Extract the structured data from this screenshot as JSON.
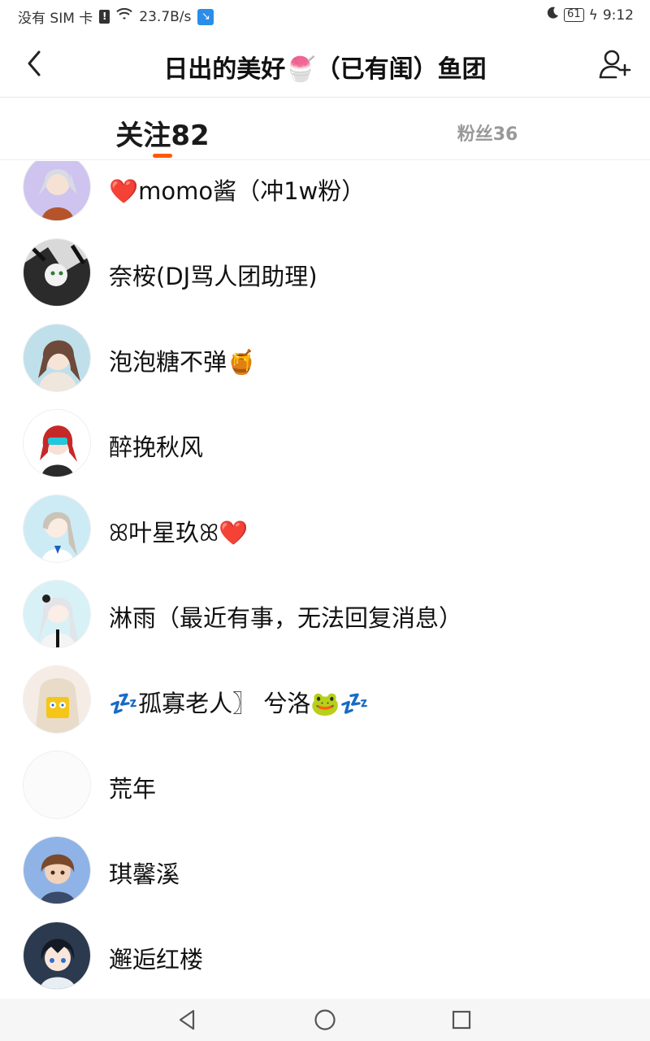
{
  "status_bar": {
    "carrier": "没有 SIM 卡",
    "sim_alert": "!",
    "net_speed": "23.7B/s",
    "battery": "61",
    "time": "9:12"
  },
  "header": {
    "title": "日出的美好🍧（已有闺）鱼团"
  },
  "tabs": [
    {
      "label": "关注82",
      "active": true
    },
    {
      "label": "粉丝36",
      "active": false
    }
  ],
  "accent_color": "#ff5a00",
  "users": [
    {
      "heart_prefix": "❤️",
      "name": "momo酱（冲1w粉）",
      "suffix": ""
    },
    {
      "heart_prefix": "",
      "name": "奈桉(DJ骂人团助理)",
      "suffix": ""
    },
    {
      "heart_prefix": "",
      "name": "泡泡糖不弹🍯",
      "suffix": ""
    },
    {
      "heart_prefix": "",
      "name": "醉挽秋风",
      "suffix": ""
    },
    {
      "heart_prefix": "",
      "name": "ꕤ叶星玖ꕤ",
      "suffix": "❤️"
    },
    {
      "heart_prefix": "",
      "name": "淋雨（最近有事，无法回复消息）",
      "suffix": ""
    },
    {
      "heart_prefix": "",
      "name": "💤孤寡老人〗 兮洛🐸💤",
      "suffix": ""
    },
    {
      "heart_prefix": "",
      "name": "荒年",
      "suffix": ""
    },
    {
      "heart_prefix": "",
      "name": "琪馨溪",
      "suffix": ""
    },
    {
      "heart_prefix": "",
      "name": "邂逅红楼",
      "suffix": ""
    }
  ]
}
